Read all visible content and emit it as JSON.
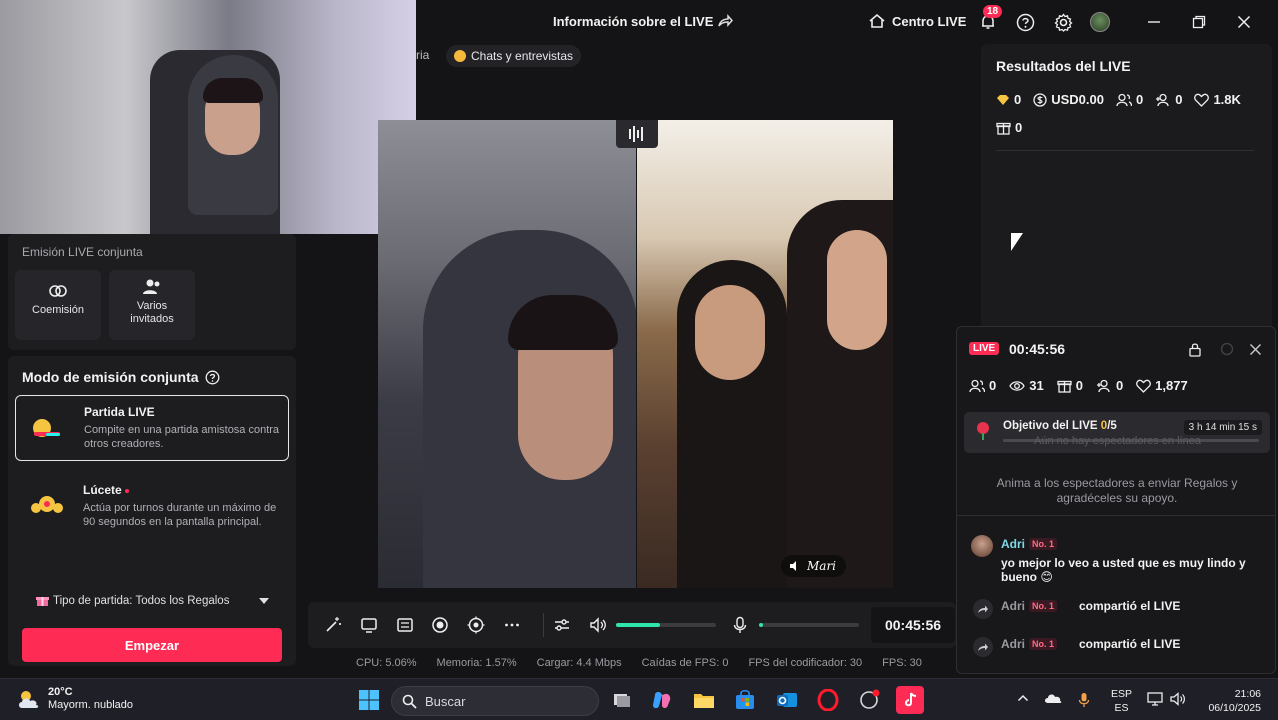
{
  "topbar": {
    "title": "Información sobre el LIVE",
    "centro_label": "Centro LIVE",
    "notifications_count": "18"
  },
  "tabs": {
    "partial_label": "ria",
    "chats_label": "Chats y entrevistas"
  },
  "left": {
    "joint_title": "Emisión LIVE conjunta",
    "tile_cohost": "Coemisión",
    "tile_multi": "Varios invitados",
    "mode_title": "Modo de emisión conjunta",
    "modes": [
      {
        "name": "Partida LIVE",
        "desc": "Compite en una partida amistosa contra otros creadores."
      },
      {
        "name": "Lúcete",
        "desc": "Actúa por turnos durante un máximo de 90 segundos en la pantalla principal."
      }
    ],
    "match_type": "Tipo de partida: Todos los Regalos",
    "start_label": "Empezar"
  },
  "video": {
    "guest_name": "Mari"
  },
  "controls": {
    "timer": "00:45:56",
    "volume_level": 0.44,
    "mic_level": 0.04
  },
  "stats": {
    "cpu": "CPU: 5.06%",
    "memory": "Memoria: 1.57%",
    "upload": "Cargar: 4.4 Mbps",
    "fps_drops": "Caídas de FPS: 0",
    "encoder_fps": "FPS del codificador: 30",
    "fps": "FPS: 30"
  },
  "results": {
    "title": "Resultados del LIVE",
    "diamonds": "0",
    "usd": "USD0.00",
    "viewers_new": "0",
    "follows": "0",
    "likes": "1.8K",
    "gifts": "0"
  },
  "live_panel": {
    "tag": "LIVE",
    "time": "00:45:56",
    "viewers": "0",
    "views": "31",
    "gifts": "0",
    "follows": "0",
    "likes": "1,877",
    "goal_title_prefix": "Objetivo del LIVE ",
    "goal_current": "0",
    "goal_total": "/5",
    "goal_time": "3 h 14 min 15 s",
    "ghost_text": "Aún no hay espectadores en línea",
    "encourage": "Anima a los espectadores a enviar Regalos y agradéceles su apoyo.",
    "messages": [
      {
        "user": "Adri",
        "rank": "No. 1",
        "text": "yo mejor lo veo a usted que es muy lindo y bueno 😊"
      },
      {
        "user": "Adri",
        "rank": "No. 1",
        "text": "compartió el LIVE"
      },
      {
        "user": "Adri",
        "rank": "No. 1",
        "text": "compartió el LIVE"
      }
    ]
  },
  "taskbar": {
    "temp": "20°C",
    "weather": "Mayorm. nublado",
    "search_placeholder": "Buscar",
    "lang_top": "ESP",
    "lang_bottom": "ES",
    "time": "21:06",
    "date": "06/10/2025"
  },
  "colors": {
    "accent": "#fe2c55",
    "level": "#2ee6a8",
    "username": "#7fd8e6"
  }
}
